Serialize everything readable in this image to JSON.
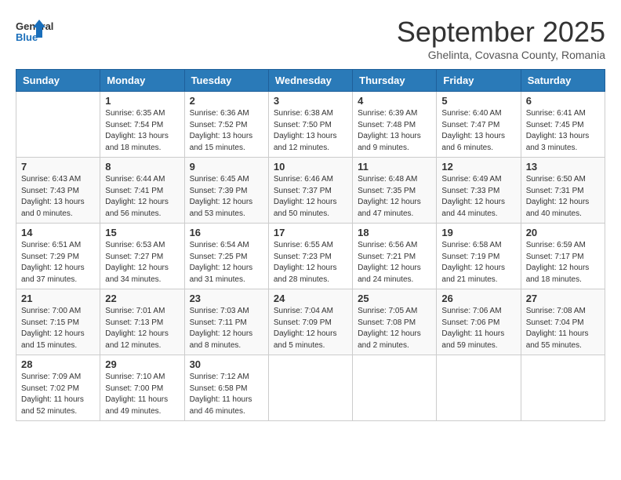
{
  "logo": {
    "general": "General",
    "blue": "Blue"
  },
  "header": {
    "month": "September 2025",
    "location": "Ghelinta, Covasna County, Romania"
  },
  "weekdays": [
    "Sunday",
    "Monday",
    "Tuesday",
    "Wednesday",
    "Thursday",
    "Friday",
    "Saturday"
  ],
  "weeks": [
    [
      {
        "day": "",
        "info": ""
      },
      {
        "day": "1",
        "info": "Sunrise: 6:35 AM\nSunset: 7:54 PM\nDaylight: 13 hours\nand 18 minutes."
      },
      {
        "day": "2",
        "info": "Sunrise: 6:36 AM\nSunset: 7:52 PM\nDaylight: 13 hours\nand 15 minutes."
      },
      {
        "day": "3",
        "info": "Sunrise: 6:38 AM\nSunset: 7:50 PM\nDaylight: 13 hours\nand 12 minutes."
      },
      {
        "day": "4",
        "info": "Sunrise: 6:39 AM\nSunset: 7:48 PM\nDaylight: 13 hours\nand 9 minutes."
      },
      {
        "day": "5",
        "info": "Sunrise: 6:40 AM\nSunset: 7:47 PM\nDaylight: 13 hours\nand 6 minutes."
      },
      {
        "day": "6",
        "info": "Sunrise: 6:41 AM\nSunset: 7:45 PM\nDaylight: 13 hours\nand 3 minutes."
      }
    ],
    [
      {
        "day": "7",
        "info": "Sunrise: 6:43 AM\nSunset: 7:43 PM\nDaylight: 13 hours\nand 0 minutes."
      },
      {
        "day": "8",
        "info": "Sunrise: 6:44 AM\nSunset: 7:41 PM\nDaylight: 12 hours\nand 56 minutes."
      },
      {
        "day": "9",
        "info": "Sunrise: 6:45 AM\nSunset: 7:39 PM\nDaylight: 12 hours\nand 53 minutes."
      },
      {
        "day": "10",
        "info": "Sunrise: 6:46 AM\nSunset: 7:37 PM\nDaylight: 12 hours\nand 50 minutes."
      },
      {
        "day": "11",
        "info": "Sunrise: 6:48 AM\nSunset: 7:35 PM\nDaylight: 12 hours\nand 47 minutes."
      },
      {
        "day": "12",
        "info": "Sunrise: 6:49 AM\nSunset: 7:33 PM\nDaylight: 12 hours\nand 44 minutes."
      },
      {
        "day": "13",
        "info": "Sunrise: 6:50 AM\nSunset: 7:31 PM\nDaylight: 12 hours\nand 40 minutes."
      }
    ],
    [
      {
        "day": "14",
        "info": "Sunrise: 6:51 AM\nSunset: 7:29 PM\nDaylight: 12 hours\nand 37 minutes."
      },
      {
        "day": "15",
        "info": "Sunrise: 6:53 AM\nSunset: 7:27 PM\nDaylight: 12 hours\nand 34 minutes."
      },
      {
        "day": "16",
        "info": "Sunrise: 6:54 AM\nSunset: 7:25 PM\nDaylight: 12 hours\nand 31 minutes."
      },
      {
        "day": "17",
        "info": "Sunrise: 6:55 AM\nSunset: 7:23 PM\nDaylight: 12 hours\nand 28 minutes."
      },
      {
        "day": "18",
        "info": "Sunrise: 6:56 AM\nSunset: 7:21 PM\nDaylight: 12 hours\nand 24 minutes."
      },
      {
        "day": "19",
        "info": "Sunrise: 6:58 AM\nSunset: 7:19 PM\nDaylight: 12 hours\nand 21 minutes."
      },
      {
        "day": "20",
        "info": "Sunrise: 6:59 AM\nSunset: 7:17 PM\nDaylight: 12 hours\nand 18 minutes."
      }
    ],
    [
      {
        "day": "21",
        "info": "Sunrise: 7:00 AM\nSunset: 7:15 PM\nDaylight: 12 hours\nand 15 minutes."
      },
      {
        "day": "22",
        "info": "Sunrise: 7:01 AM\nSunset: 7:13 PM\nDaylight: 12 hours\nand 12 minutes."
      },
      {
        "day": "23",
        "info": "Sunrise: 7:03 AM\nSunset: 7:11 PM\nDaylight: 12 hours\nand 8 minutes."
      },
      {
        "day": "24",
        "info": "Sunrise: 7:04 AM\nSunset: 7:09 PM\nDaylight: 12 hours\nand 5 minutes."
      },
      {
        "day": "25",
        "info": "Sunrise: 7:05 AM\nSunset: 7:08 PM\nDaylight: 12 hours\nand 2 minutes."
      },
      {
        "day": "26",
        "info": "Sunrise: 7:06 AM\nSunset: 7:06 PM\nDaylight: 11 hours\nand 59 minutes."
      },
      {
        "day": "27",
        "info": "Sunrise: 7:08 AM\nSunset: 7:04 PM\nDaylight: 11 hours\nand 55 minutes."
      }
    ],
    [
      {
        "day": "28",
        "info": "Sunrise: 7:09 AM\nSunset: 7:02 PM\nDaylight: 11 hours\nand 52 minutes."
      },
      {
        "day": "29",
        "info": "Sunrise: 7:10 AM\nSunset: 7:00 PM\nDaylight: 11 hours\nand 49 minutes."
      },
      {
        "day": "30",
        "info": "Sunrise: 7:12 AM\nSunset: 6:58 PM\nDaylight: 11 hours\nand 46 minutes."
      },
      {
        "day": "",
        "info": ""
      },
      {
        "day": "",
        "info": ""
      },
      {
        "day": "",
        "info": ""
      },
      {
        "day": "",
        "info": ""
      }
    ]
  ]
}
